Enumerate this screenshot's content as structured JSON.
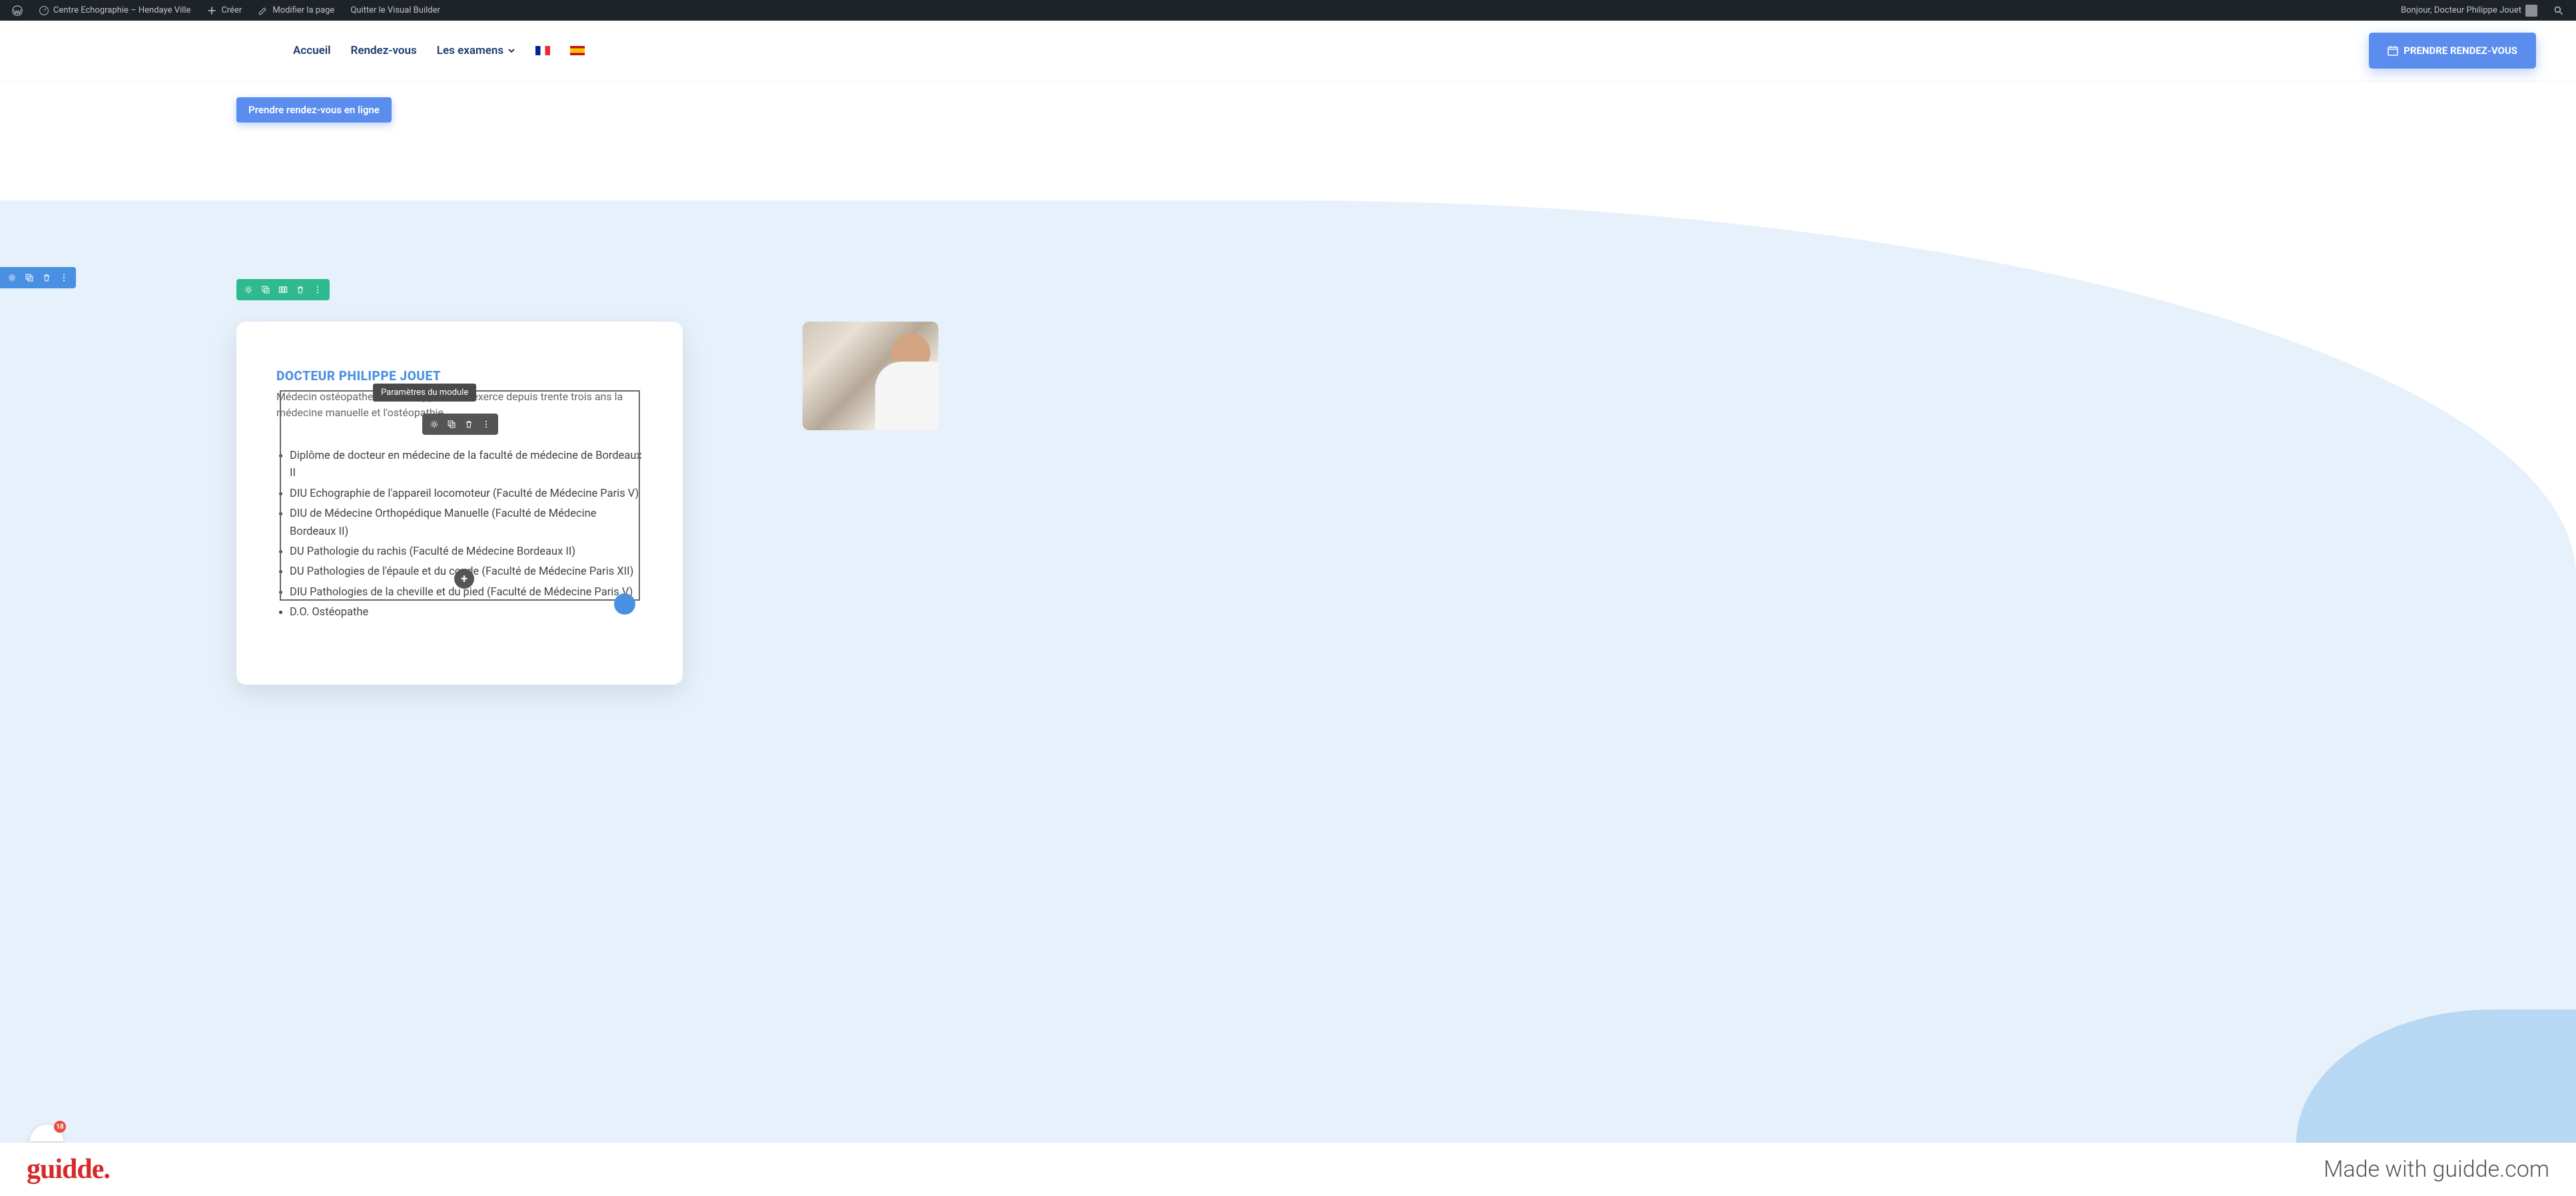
{
  "wp_bar": {
    "site_name": "Centre Echographie – Hendaye Ville",
    "create": "Créer",
    "edit_page": "Modifier la page",
    "exit_vb": "Quitter le Visual Builder",
    "greeting": "Bonjour, Docteur Philippe Jouet"
  },
  "nav": {
    "home": "Accueil",
    "appointment": "Rendez-vous",
    "exams": "Les examens"
  },
  "header_cta": "PRENDRE RENDEZ-VOUS",
  "inline_btn": "Prendre rendez-vous en ligne",
  "tooltip": "Paramètres du module",
  "card": {
    "title": "DOCTEUR PHILIPPE JOUET",
    "intro": "Médecin ostéopathe, le Dr Philippe Jouet exerce depuis trente trois ans la médecine manuelle et l'ostéopathie.",
    "bullets": [
      "Diplôme de docteur en médecine de la faculté de médecine de Bordeaux II",
      "DIU Echographie de l'appareil locomoteur (Faculté de Médecine Paris V)",
      "DIU de Médecine Orthopédique Manuelle (Faculté de Médecine Bordeaux II)",
      "DU Pathologie du rachis (Faculté de Médecine Bordeaux II)",
      "DU Pathologies de l'épaule et du coude (Faculté de Médecine Paris XII)",
      "DIU Pathologies de la cheville et du pied (Faculté de Médecine Paris V)",
      "D.O. Ostéopathe"
    ]
  },
  "notif_count": "18",
  "footer": {
    "logo": "guidde.",
    "made_with": "Made with guidde.com"
  }
}
